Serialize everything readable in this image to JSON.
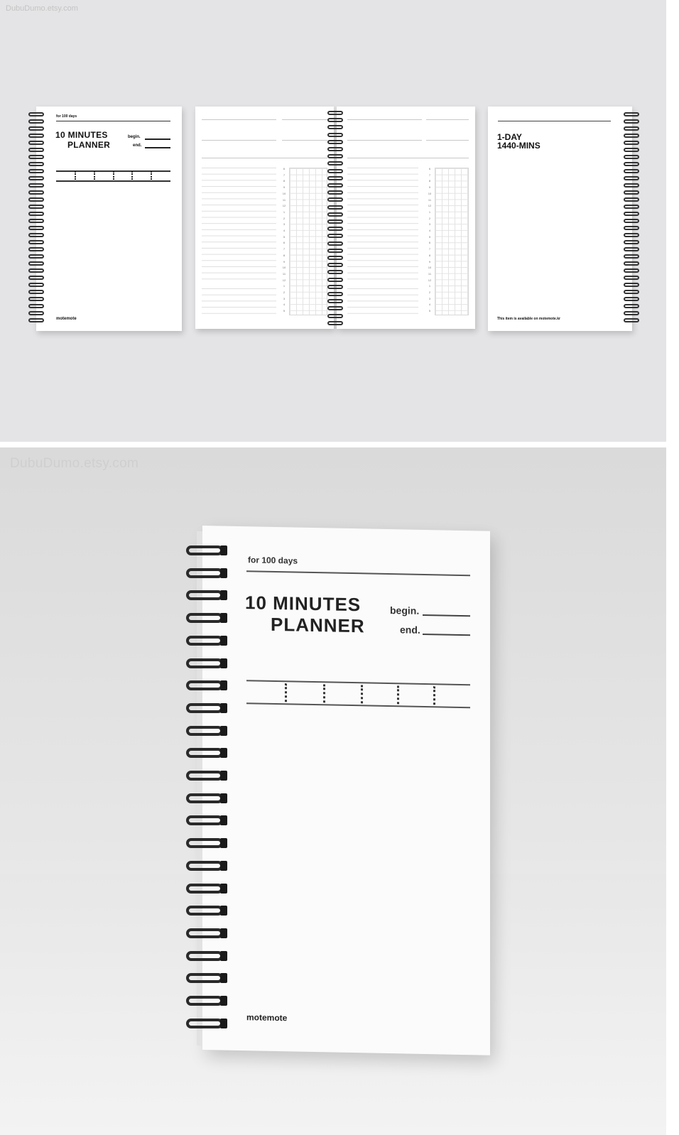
{
  "watermark": "DubuDumo.etsy.com",
  "cover": {
    "for_days": "for 100 days",
    "title_line1": "10 MINUTES",
    "title_line2": "PLANNER",
    "begin_label": "begin.",
    "end_label": "end.",
    "brand": "motemote"
  },
  "back": {
    "title_line1": "1-DAY",
    "title_line2": "1440-MINS",
    "availability": "This item is available on motemote.kr"
  },
  "inner": {
    "hours": [
      "6",
      "7",
      "8",
      "9",
      "10",
      "11",
      "12",
      "1",
      "2",
      "3",
      "4",
      "5",
      "6",
      "7",
      "8",
      "9",
      "10",
      "11",
      "12",
      "1",
      "2",
      "3",
      "4",
      "5"
    ]
  },
  "colors": {
    "background_top": "#e4e4e6",
    "page": "#ffffff",
    "ink": "#111111"
  }
}
